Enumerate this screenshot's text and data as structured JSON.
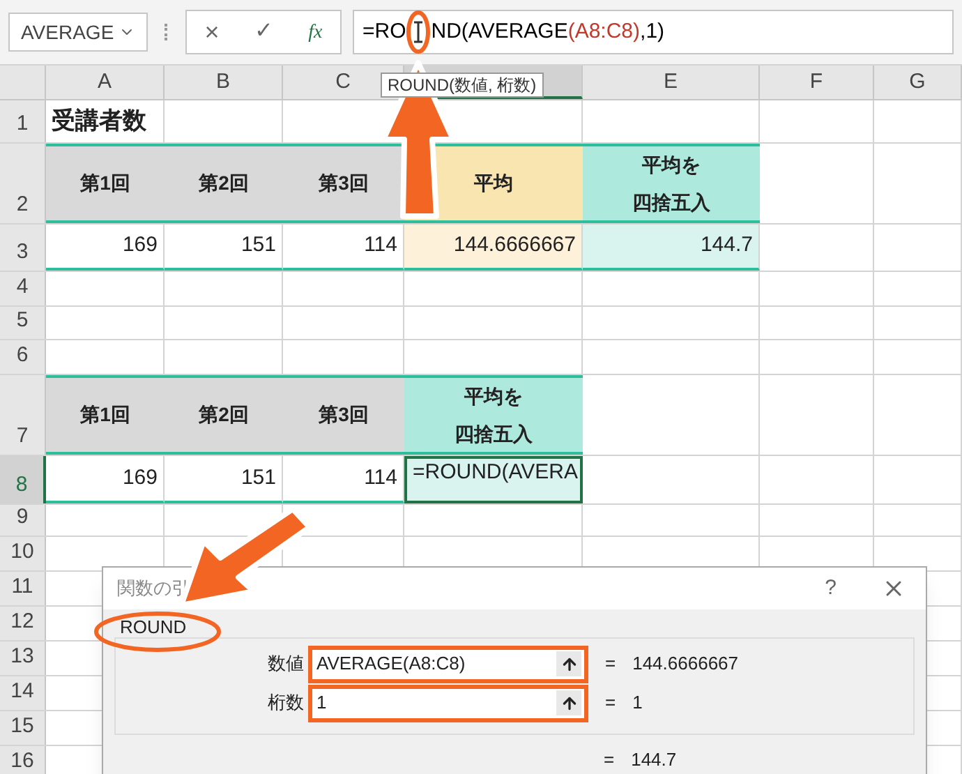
{
  "name_box": {
    "value": "AVERAGE"
  },
  "formula_buttons": {
    "cancel": "×",
    "enter": "✓",
    "function": "fx"
  },
  "formula_bar": {
    "segments": [
      {
        "text": "=RO",
        "color": "#000000"
      },
      {
        "text": "ND(AVERAGE",
        "color": "#000000"
      },
      {
        "text": "(A8:C8)",
        "color": "#c0392b"
      },
      {
        "text": ",1)",
        "color": "#000000"
      }
    ]
  },
  "tooltip": {
    "text": "ROUND(数値, 桁数)"
  },
  "columns": [
    {
      "label": "A",
      "selected": false
    },
    {
      "label": "B",
      "selected": false
    },
    {
      "label": "C",
      "selected": false
    },
    {
      "selected": true
    },
    {
      "label": "E",
      "selected": false
    },
    {
      "label": "F",
      "selected": false
    },
    {
      "label": "G",
      "selected": false
    }
  ],
  "rows": [
    {
      "label": "1",
      "selected": false,
      "cells": [
        {
          "kind": "title",
          "lines": [
            "受講者数"
          ]
        }
      ]
    },
    {
      "label": "2",
      "selected": false,
      "cells": [
        {
          "kind": "head",
          "lines": [
            "第1回"
          ],
          "color": "#d9d9d9"
        },
        {
          "kind": "head",
          "lines": [
            "第2回"
          ],
          "color": "#d9d9d9"
        },
        {
          "kind": "head",
          "lines": [
            "第3回"
          ],
          "color": "#d9d9d9"
        },
        {
          "kind": "head",
          "lines": [
            "平均"
          ],
          "color": "#f8e5b0"
        },
        {
          "kind": "head",
          "lines": [
            "平均を",
            "四捨五入"
          ],
          "color": "#aee9dd"
        }
      ]
    },
    {
      "label": "3",
      "selected": false,
      "cells": [
        {
          "kind": "num",
          "lines": [
            "169"
          ],
          "color": "#ffffff"
        },
        {
          "kind": "num",
          "lines": [
            "151"
          ],
          "color": "#ffffff"
        },
        {
          "kind": "num",
          "lines": [
            "114"
          ],
          "color": "#ffffff"
        },
        {
          "kind": "num",
          "lines": [
            "144.6666667"
          ],
          "color": "#fdf2d9"
        },
        {
          "kind": "num",
          "lines": [
            "144.7"
          ],
          "color": "#d9f3ee"
        }
      ]
    },
    {
      "label": "4",
      "selected": false,
      "cells": []
    },
    {
      "label": "5",
      "selected": false,
      "cells": []
    },
    {
      "label": "6",
      "selected": false,
      "cells": []
    },
    {
      "label": "7",
      "selected": false,
      "cells": [
        {
          "kind": "head",
          "lines": [
            "第1回"
          ],
          "color": "#d9d9d9"
        },
        {
          "kind": "head",
          "lines": [
            "第2回"
          ],
          "color": "#d9d9d9"
        },
        {
          "kind": "head",
          "lines": [
            "第3回"
          ],
          "color": "#d9d9d9"
        },
        {
          "kind": "head",
          "lines": [
            "平均を",
            "四捨五入"
          ],
          "color": "#aee9dd"
        }
      ]
    },
    {
      "label": "8",
      "selected": true,
      "cells": [
        {
          "kind": "num",
          "lines": [
            "169"
          ],
          "color": "#ffffff"
        },
        {
          "kind": "num",
          "lines": [
            "151"
          ],
          "color": "#ffffff"
        },
        {
          "kind": "num",
          "lines": [
            "114"
          ],
          "color": "#ffffff"
        },
        {
          "kind": "edit",
          "lines": [
            "=ROUND(AVERA"
          ],
          "color": "#d9f3ee"
        }
      ]
    },
    {
      "label": "9",
      "selected": false,
      "cells": []
    },
    {
      "label": "10",
      "selected": false,
      "cells": []
    },
    {
      "label": "11",
      "selected": false,
      "cells": []
    },
    {
      "label": "12",
      "selected": false,
      "cells": []
    },
    {
      "label": "13",
      "selected": false,
      "cells": []
    },
    {
      "label": "14",
      "selected": false,
      "cells": []
    },
    {
      "label": "15",
      "selected": false,
      "cells": []
    },
    {
      "label": "16",
      "selected": false,
      "cells": []
    }
  ],
  "dialog": {
    "title": "関数の引",
    "help": "?",
    "function_name": "ROUND",
    "args": [
      {
        "label": "数値",
        "value": "AVERAGE(A8:C8)",
        "sign": "=",
        "result": "144.6666667"
      },
      {
        "label": "桁数",
        "value": "1",
        "sign": "=",
        "result": "1"
      }
    ],
    "result_sign": "=",
    "result": "144.7"
  }
}
